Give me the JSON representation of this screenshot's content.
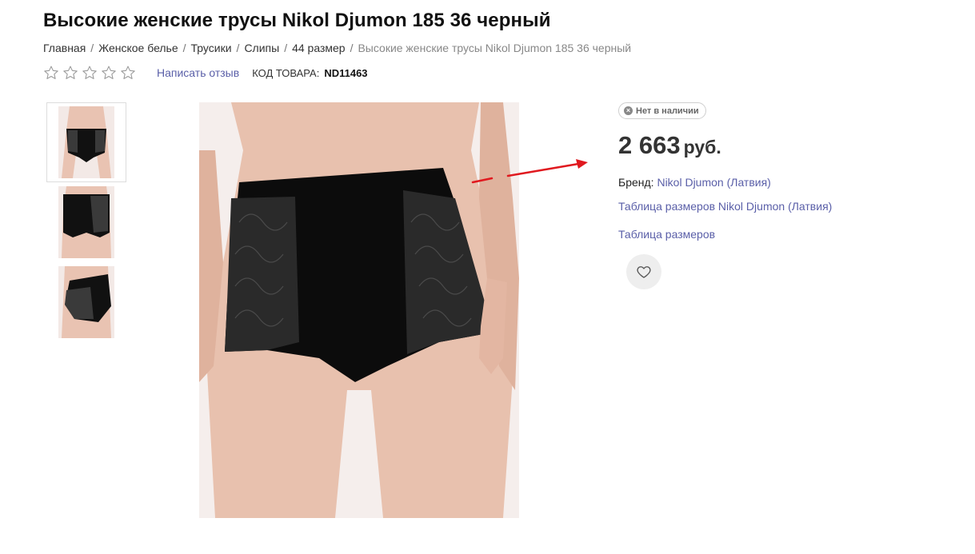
{
  "product": {
    "title": "Высокие женские трусы Nikol Djumon 185 36 черный",
    "sku_label": "КОД ТОВАРА:",
    "sku": "ND11463",
    "review_link": "Написать отзыв",
    "rating_stars": 0,
    "rating_max": 5
  },
  "breadcrumb": [
    {
      "label": "Главная"
    },
    {
      "label": "Женское белье"
    },
    {
      "label": "Трусики"
    },
    {
      "label": "Слипы"
    },
    {
      "label": "44 размер"
    },
    {
      "label": "Высокие женские трусы Nikol Djumon 185 36 черный"
    }
  ],
  "breadcrumb_separator": "/",
  "gallery": {
    "thumbnails": [
      {
        "icon": "front-view-photo",
        "active": true
      },
      {
        "icon": "back-view-photo",
        "active": false
      },
      {
        "icon": "side-view-photo",
        "active": false
      }
    ],
    "main_icon": "product-photo"
  },
  "offer": {
    "stock_status": "Нет в наличии",
    "price": "2 663",
    "currency": "руб.",
    "brand_label": "Бренд:",
    "brand_name": "Nikol Djumon (Латвия)",
    "size_table_brand": "Таблица размеров Nikol Djumon (Латвия)",
    "size_table": "Таблица размеров"
  },
  "colors": {
    "link": "#5a5fa8",
    "annotation_arrow": "#e0191f",
    "badge_border": "#cfcfcf"
  }
}
